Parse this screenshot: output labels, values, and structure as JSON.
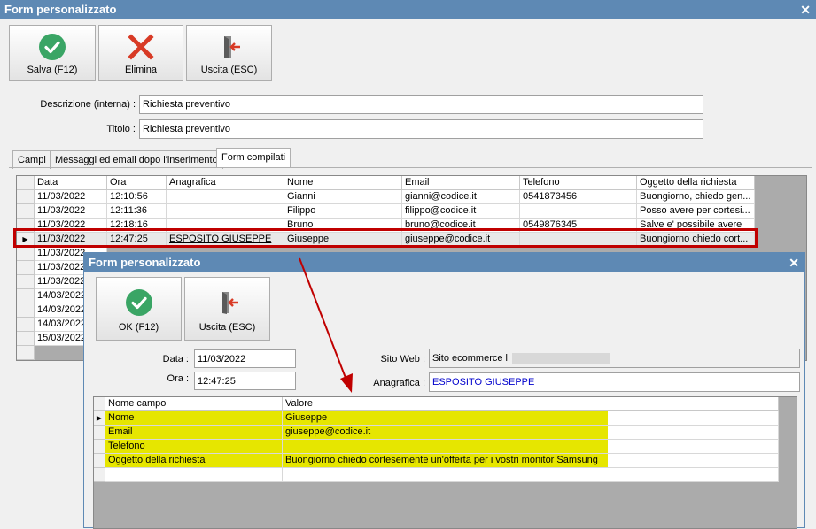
{
  "window": {
    "title": "Form personalizzato"
  },
  "toolbar": {
    "save": "Salva (F12)",
    "delete": "Elimina",
    "exit": "Uscita (ESC)"
  },
  "fields": {
    "descrizione_label": "Descrizione (interna) :",
    "descrizione_value": "Richiesta preventivo",
    "titolo_label": "Titolo :",
    "titolo_value": "Richiesta preventivo"
  },
  "tabs": [
    "Campi",
    "Messaggi ed email dopo l'inserimento",
    "Form compilati"
  ],
  "grid": {
    "headers": [
      "Data",
      "Ora",
      "Anagrafica",
      "Nome",
      "Email",
      "Telefono",
      "Oggetto della richiesta"
    ],
    "rows": [
      [
        "11/03/2022",
        "12:10:56",
        "",
        "Gianni",
        "gianni@codice.it",
        "0541873456",
        "Buongiorno, chiedo gen..."
      ],
      [
        "11/03/2022",
        "12:11:36",
        "",
        "Filippo",
        "filippo@codice.it",
        "",
        "Posso avere per cortesi..."
      ],
      [
        "11/03/2022",
        "12:18:16",
        "",
        "Bruno",
        "bruno@codice.it",
        "0549876345",
        "Salve e' possibile avere"
      ],
      [
        "11/03/2022",
        "12:47:25",
        "ESPOSITO GIUSEPPE",
        "Giuseppe",
        "giuseppe@codice.it",
        "",
        "Buongiorno chiedo cort..."
      ],
      [
        "11/03/2022"
      ],
      [
        "11/03/2022"
      ],
      [
        "11/03/2022"
      ],
      [
        "14/03/2022"
      ],
      [
        "14/03/2022"
      ],
      [
        "14/03/2022"
      ],
      [
        "15/03/2022"
      ]
    ]
  },
  "dialog": {
    "title": "Form personalizzato",
    "ok": "OK (F12)",
    "exit": "Uscita (ESC)",
    "data_label": "Data :",
    "data_value": "11/03/2022",
    "ora_label": "Ora :",
    "ora_value": "12:47:25",
    "sito_label": "Sito Web :",
    "sito_value": "Sito ecommerce l",
    "anagrafica_label": "Anagrafica :",
    "anagrafica_value": "ESPOSITO GIUSEPPE",
    "grid_headers": [
      "Nome campo",
      "Valore"
    ],
    "grid_rows": [
      [
        "Nome",
        "Giuseppe"
      ],
      [
        "Email",
        "giuseppe@codice.it"
      ],
      [
        "Telefono",
        ""
      ],
      [
        "Oggetto della richiesta",
        "Buongiorno chiedo cortesemente un'offerta per i vostri monitor Samsung"
      ]
    ]
  },
  "colors": {
    "titlebar": "#5e89b4",
    "highlight_red": "#c00000",
    "yellow": "#e6e600",
    "link_blue": "#0000cc"
  }
}
